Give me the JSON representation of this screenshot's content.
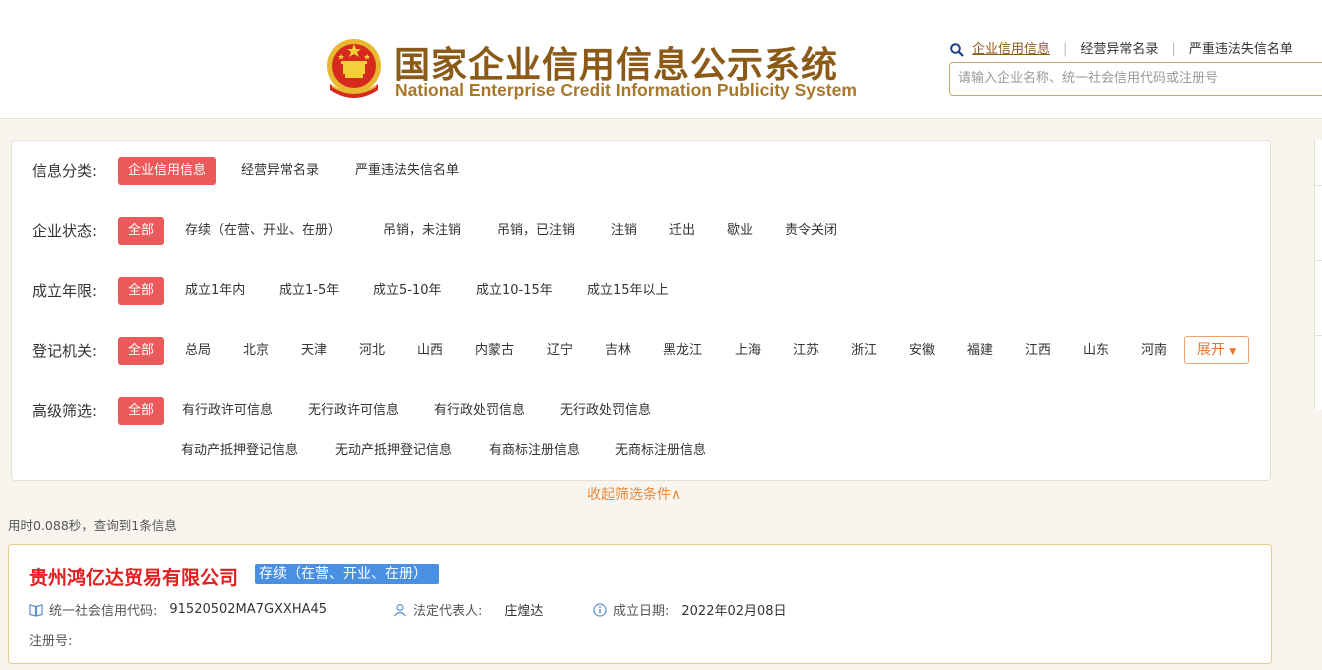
{
  "header": {
    "title_cn": "国家企业信用信息公示系统",
    "title_en": "National Enterprise Credit Information Publicity System",
    "links": [
      "企业信用信息",
      "经营异常名录",
      "严重违法失信名单"
    ],
    "search_placeholder": "请输入企业名称、统一社会信用代码或注册号",
    "brand_color": "#8a5a16"
  },
  "filters": {
    "category": {
      "label": "信息分类:",
      "options": [
        "企业信用信息",
        "经营异常名录",
        "严重违法失信名单"
      ],
      "selected": "企业信用信息"
    },
    "status": {
      "label": "企业状态:",
      "options": [
        "全部",
        "存续（在营、开业、在册）",
        "吊销，未注销",
        "吊销，已注销",
        "注销",
        "迁出",
        "歇业",
        "责令关闭"
      ],
      "selected": "全部"
    },
    "age": {
      "label": "成立年限:",
      "options": [
        "全部",
        "成立1年内",
        "成立1-5年",
        "成立5-10年",
        "成立10-15年",
        "成立15年以上"
      ],
      "selected": "全部"
    },
    "authority": {
      "label": "登记机关:",
      "options": [
        "全部",
        "总局",
        "北京",
        "天津",
        "河北",
        "山西",
        "内蒙古",
        "辽宁",
        "吉林",
        "黑龙江",
        "上海",
        "江苏",
        "浙江",
        "安徽",
        "福建",
        "江西",
        "山东",
        "河南"
      ],
      "selected": "全部",
      "expand_label": "展开"
    },
    "advanced": {
      "label": "高级筛选:",
      "options_row1": [
        "全部",
        "有行政许可信息",
        "无行政许可信息",
        "有行政处罚信息",
        "无行政处罚信息"
      ],
      "options_row2": [
        "有动产抵押登记信息",
        "无动产抵押登记信息",
        "有商标注册信息",
        "无商标注册信息"
      ],
      "selected": "全部"
    },
    "collapse_label": "收起筛选条件∧",
    "accent_color": "#ea5a5a"
  },
  "results": {
    "stats": "用时0.088秒，查询到1条信息",
    "items": [
      {
        "name": "贵州鸿亿达贸易有限公司",
        "status": "存续（在营、开业、在册）",
        "credit_code_label": "统一社会信用代码:",
        "credit_code": "91520502MA7GXXHA45",
        "legal_rep_label": "法定代表人:",
        "legal_rep": "庄煌达",
        "founded_label": "成立日期:",
        "founded": "2022年02月08日",
        "reg_no_label": "注册号:",
        "reg_no": ""
      }
    ]
  }
}
